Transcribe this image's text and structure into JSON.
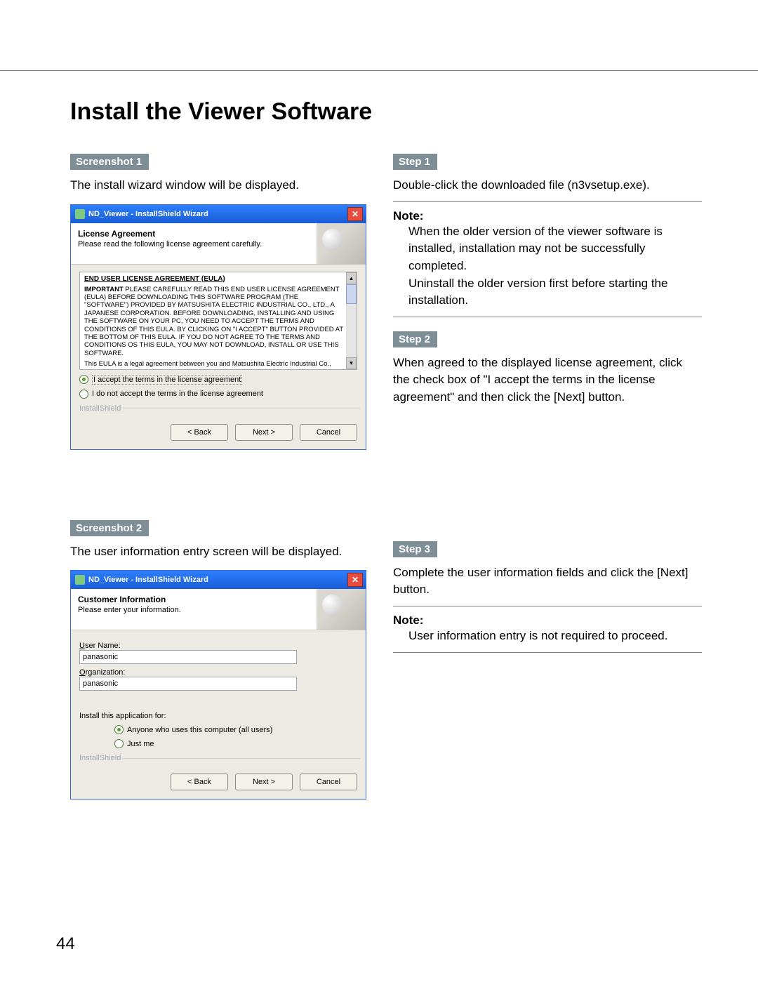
{
  "page_number": "44",
  "title": "Install the Viewer Software",
  "tags": {
    "screenshot1": "Screenshot 1",
    "screenshot2": "Screenshot 2",
    "step1": "Step 1",
    "step2": "Step 2",
    "step3": "Step 3"
  },
  "left": {
    "s1_text": "The install wizard window will be displayed.",
    "s2_text": "The user information entry screen will be displayed."
  },
  "right": {
    "step1_text": "Double-click the downloaded file (n3vsetup.exe).",
    "note_label": "Note:",
    "note1_a": "When the older version of the viewer software is installed, installation may not be successfully completed.",
    "note1_b": "Uninstall the older version first before starting the installation.",
    "step2_text": "When agreed to the displayed license agreement, click the check box of \"I accept the terms in the license agreement\" and then click the [Next] button.",
    "step3_text": "Complete the user information fields and click the [Next] button.",
    "note2": "User information entry is not required to proceed."
  },
  "dialog1": {
    "title": "ND_Viewer - InstallShield Wizard",
    "heading": "License Agreement",
    "subheading": "Please read the following license agreement carefully.",
    "eula_title": "END USER LICENSE AGREEMENT (EULA)",
    "eula_body1": "IMPORTANT",
    "eula_body1b": "PLEASE CAREFULLY READ THIS END USER LICENSE AGREEMENT (EULA) BEFORE DOWNLOADING THIS SOFTWARE PROGRAM (THE \"SOFTWARE\") PROVIDED BY MATSUSHITA ELECTRIC INDUSTRIAL CO., LTD., A JAPANESE CORPORATION. BEFORE DOWNLOADING, INSTALLING AND USING THE SOFTWARE ON YOUR PC, YOU NEED TO ACCEPT THE TERMS AND CONDITIONS OF THIS EULA. BY CLICKING ON \"I ACCEPT\" BUTTON PROVIDED AT THE BOTTOM OF THIS EULA. IF YOU DO NOT AGREE TO THE TERMS AND CONDITIONS OS THIS EULA, YOU MAY NOT DOWNLOAD, INSTALL OR USE THIS SOFTWARE.",
    "eula_body2": "This EULA is a legal agreement between you and Matsushita Electric Industrial Co., Ltd.",
    "accept": "I accept the terms in the license agreement",
    "reject": "I do not accept the terms in the license agreement",
    "brand": "InstallShield",
    "back": "< Back",
    "next": "Next >",
    "cancel": "Cancel"
  },
  "dialog2": {
    "title": "ND_Viewer - InstallShield Wizard",
    "heading": "Customer Information",
    "subheading": "Please enter your information.",
    "user_name_label": "User Name:",
    "user_name_value": "panasonic",
    "org_label": "Organization:",
    "org_value": "panasonic",
    "install_for": "Install this application for:",
    "opt_all": "Anyone who uses this computer (all users)",
    "opt_me": "Just me",
    "brand": "InstallShield",
    "back": "< Back",
    "next": "Next >",
    "cancel": "Cancel"
  }
}
